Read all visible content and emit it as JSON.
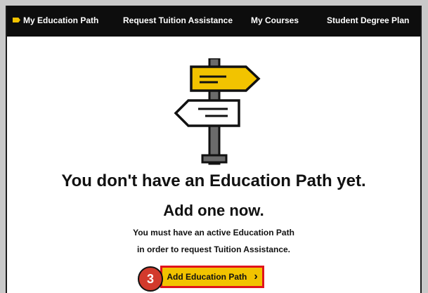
{
  "nav": {
    "items": [
      {
        "label": "My Education Path",
        "active": true
      },
      {
        "label": "Request Tuition Assistance",
        "active": false
      },
      {
        "label": "My Courses",
        "active": false
      },
      {
        "label": "Student Degree Plan",
        "active": false
      }
    ]
  },
  "empty_state": {
    "headline": "You don't have an Education Path yet.",
    "subheadline": "Add one now.",
    "message_line1": "You must have an active Education Path",
    "message_line2": "in order to request Tuition Assistance."
  },
  "actions": {
    "add_label": "Add Education Path",
    "add_arrow": "›"
  },
  "annotation": {
    "step_number": "3"
  },
  "colors": {
    "nav_bg": "#0d0d0d",
    "accent": "#f2c300",
    "highlight_border": "#e0141c",
    "badge": "#d23a2c"
  },
  "icons": [
    "signpost-icon",
    "chevron-right-icon"
  ]
}
